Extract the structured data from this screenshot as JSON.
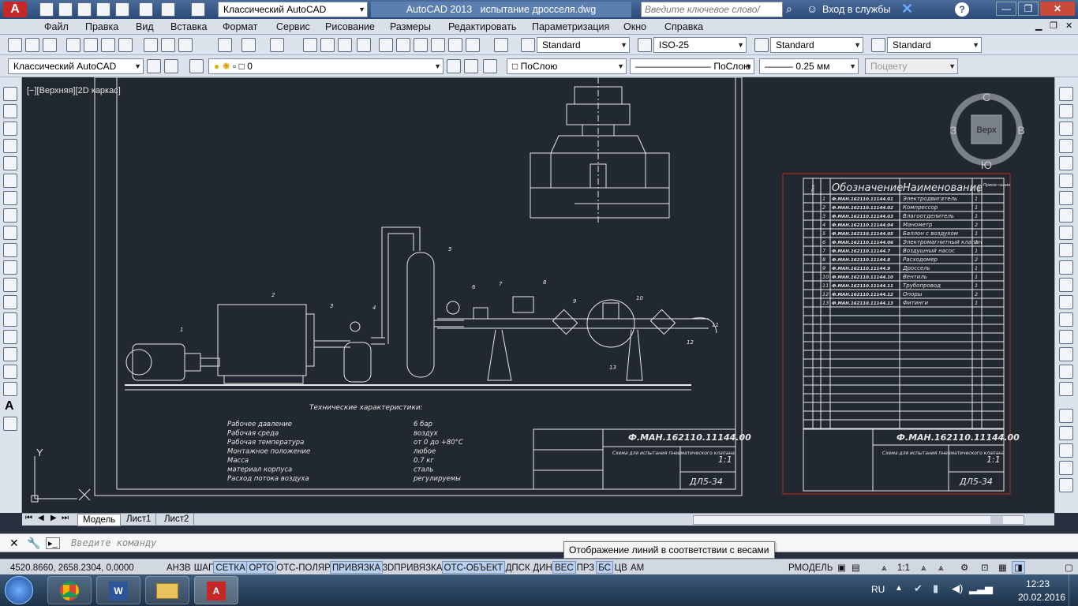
{
  "title": {
    "app": "AutoCAD 2013",
    "file": "испытание дросселя.dwg",
    "workspace": "Классический AutoCAD",
    "search_placeholder": "Введите ключевое слово/фразу",
    "signin": "Вход в службы"
  },
  "menu": [
    "Файл",
    "Правка",
    "Вид",
    "Вставка",
    "Формат",
    "Сервис",
    "Рисование",
    "Размеры",
    "Редактировать",
    "Параметризация",
    "Окно",
    "Справка"
  ],
  "styles": {
    "text": "Standard",
    "dim": "ISO-25",
    "table": "Standard",
    "mleader": "Standard"
  },
  "layers": {
    "workspace": "Классический AutoCAD",
    "layer": "0",
    "color": "ПоСлою",
    "linetype": "ПоСлою",
    "lineweight": "0.25 мм",
    "plot": "Поцвету"
  },
  "viewport": {
    "label": "[−][Верхняя][2D каркас]",
    "viewcube": {
      "top": "Верх",
      "n": "С",
      "s": "Ю",
      "w": "З",
      "e": "В"
    },
    "y_axis": "Y"
  },
  "drawing": {
    "tech_title": "Технические характеристики:",
    "specs": [
      {
        "k": "Рабочее давление",
        "v": "6 бар"
      },
      {
        "k": "Рабочая среда",
        "v": "воздух"
      },
      {
        "k": "Рабочая температура",
        "v": "от 0 до +80°С"
      },
      {
        "k": "Монтажное положение",
        "v": "любое"
      },
      {
        "k": "Масса",
        "v": "0.7 кг"
      },
      {
        "k": "материал корпуса",
        "v": "сталь"
      },
      {
        "k": "Расход потока воздуха",
        "v": "регулируемы"
      }
    ],
    "stamp_code": "Ф.МАН.162110.11144.00",
    "stamp_title": "Схема для испытания пневматического клапана",
    "scale": "1:1",
    "group": "ДЛ5-34",
    "labels": [
      "1",
      "2",
      "3",
      "4",
      "5",
      "6",
      "7",
      "8",
      "9",
      "10",
      "11",
      "12",
      "13"
    ]
  },
  "spec_table": {
    "headers": {
      "pos": "Поз.",
      "designation": "Обозначение",
      "name": "Наименование",
      "qty": "Кол.",
      "note": "Приме-чание"
    },
    "rows": [
      {
        "n": "1",
        "d": "Ф.МАН.162110.11144.01",
        "name": "Электродвигатель",
        "q": "1"
      },
      {
        "n": "2",
        "d": "Ф.МАН.162110.11144.02",
        "name": "Компрессор",
        "q": "1"
      },
      {
        "n": "3",
        "d": "Ф.МАН.162110.11144.03",
        "name": "Влагоотделитель",
        "q": "1"
      },
      {
        "n": "4",
        "d": "Ф.МАН.162110.11144.04",
        "name": "Манометр",
        "q": "2"
      },
      {
        "n": "5",
        "d": "Ф.МАН.162110.11144.05",
        "name": "Баллон с воздухом",
        "q": "1"
      },
      {
        "n": "6",
        "d": "Ф.МАН.162110.11144.06",
        "name": "Электромагнитный клапан",
        "q": "1"
      },
      {
        "n": "7",
        "d": "Ф.МАН.162110.11144.7",
        "name": "Воздушный насос",
        "q": "1"
      },
      {
        "n": "8",
        "d": "Ф.МАН.162110.11144.8",
        "name": "Расходомер",
        "q": "2"
      },
      {
        "n": "9",
        "d": "Ф.МАН.162110.11144.9",
        "name": "Дроссель",
        "q": "1"
      },
      {
        "n": "10",
        "d": "Ф.МАН.162110.11144.10",
        "name": "Вентиль",
        "q": "1"
      },
      {
        "n": "11",
        "d": "Ф.МАН.162110.11144.11",
        "name": "Трубопровод",
        "q": "1"
      },
      {
        "n": "12",
        "d": "Ф.МАН.162110.11144.12",
        "name": "Опоры",
        "q": "2"
      },
      {
        "n": "13",
        "d": "Ф.МАН.162110.11144.13",
        "name": "Фитинги",
        "q": "1"
      }
    ]
  },
  "tabs": [
    "Модель",
    "Лист1",
    "Лист2"
  ],
  "command": {
    "placeholder": "Введите команду",
    "tooltip": "Отображение линий в соответствии с весами"
  },
  "status": {
    "coords": "4520.8660, 2658.2304, 0.0000",
    "toggles": [
      "АНЗВ",
      "ШАГ",
      "СЕТКА",
      "ОРТО",
      "ОТС-ПОЛЯР",
      "ПРИВЯЗКА",
      "3DПРИВЯЗКА",
      "ОТС-ОБЪЕКТ",
      "ДПСК",
      "ДИН",
      "ВЕС",
      "ПРЗ",
      "БС",
      "ЦВ",
      "АМ"
    ],
    "toggles_on": [
      false,
      false,
      true,
      true,
      false,
      true,
      false,
      true,
      false,
      false,
      true,
      false,
      true,
      false,
      false
    ],
    "model": "РМОДЕЛЬ",
    "anno_scale": "1:1"
  },
  "tray": {
    "lang": "RU",
    "time": "12:23",
    "date": "20.02.2016"
  },
  "colors": {
    "titlebar": "#2b4a78",
    "drawing_bg": "#212830",
    "lines": "#e8e8e8",
    "highlight": "#cc2222"
  }
}
